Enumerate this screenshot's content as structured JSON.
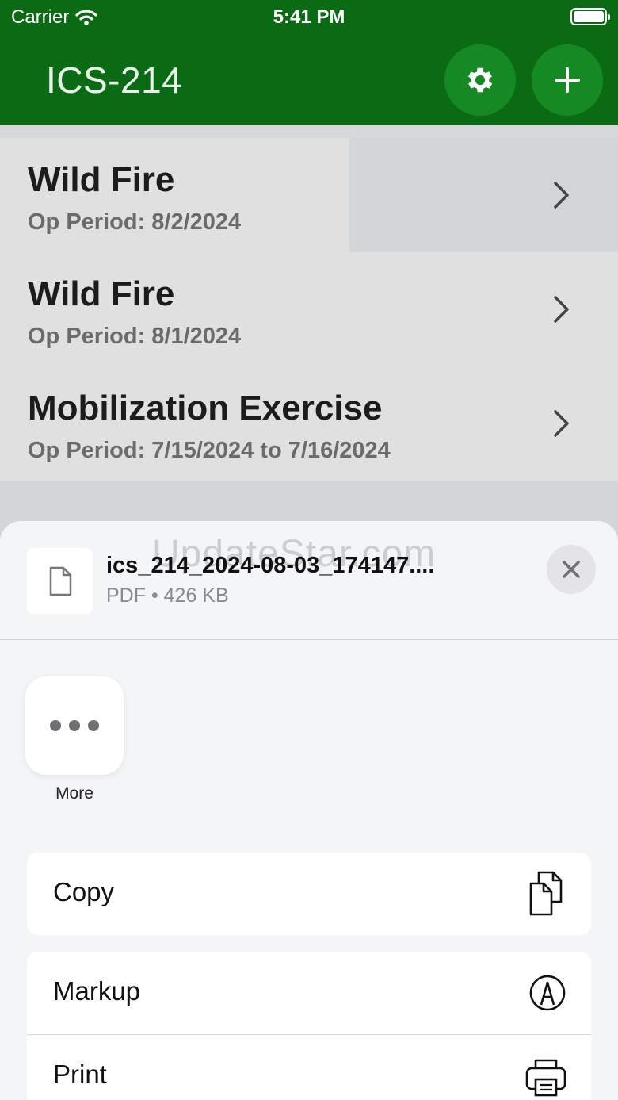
{
  "status_bar": {
    "carrier": "Carrier",
    "time": "5:41 PM"
  },
  "nav": {
    "title": "ICS-214",
    "icons": [
      "gear-icon",
      "plus-icon"
    ]
  },
  "list": {
    "items": [
      {
        "title": "Wild Fire",
        "sub": "Op Period:  8/2/2024"
      },
      {
        "title": "Wild Fire",
        "sub": "Op Period:  8/1/2024"
      },
      {
        "title": "Mobilization Exercise",
        "sub": "Op Period:  7/15/2024 to 7/16/2024"
      }
    ]
  },
  "share_sheet": {
    "file_name": "ics_214_2024-08-03_174147....",
    "file_meta": "PDF • 426 KB",
    "watermark": "UpdateStar.com",
    "apps": [
      {
        "label": "More",
        "icon": "more-dots-icon"
      }
    ],
    "actions": [
      {
        "label": "Copy",
        "icon": "copy-icon"
      },
      {
        "label": "Markup",
        "icon": "markup-icon"
      },
      {
        "label": "Print",
        "icon": "printer-icon"
      }
    ]
  },
  "colors": {
    "brand_green": "#0b6b14",
    "button_green": "#158a22"
  }
}
